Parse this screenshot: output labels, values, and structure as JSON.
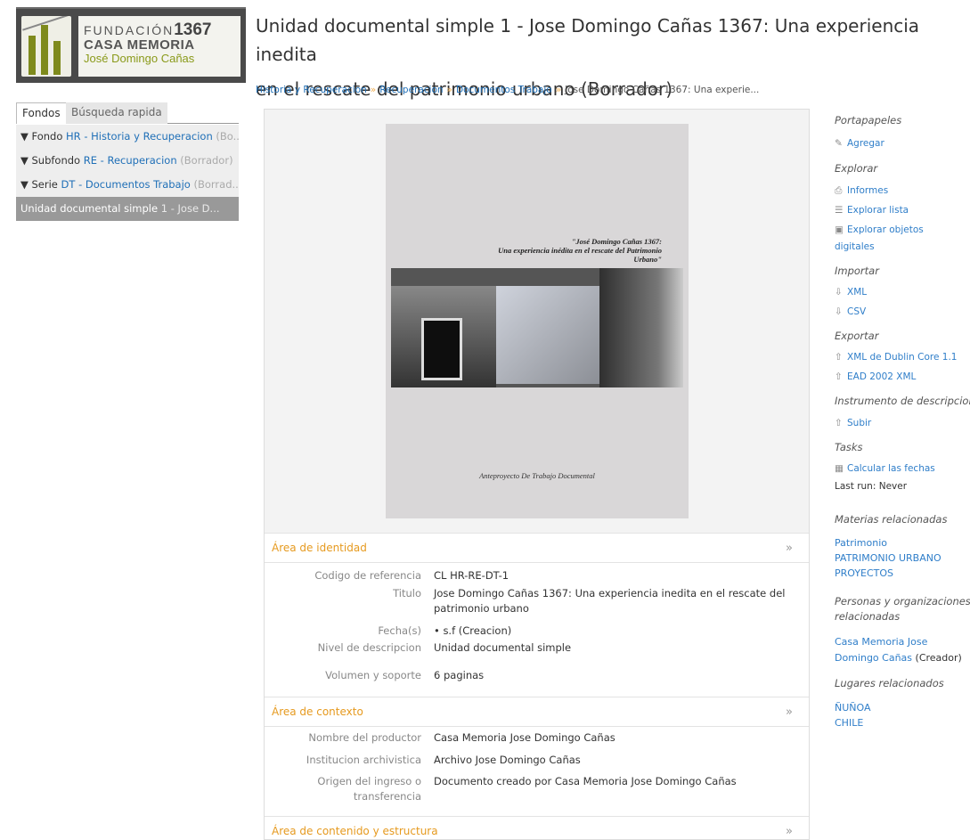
{
  "logo": {
    "line1_prefix": "FUNDACIÓN",
    "line1_number": "1367",
    "line2": "CASA MEMORIA",
    "line3": "José Domingo Cañas"
  },
  "sidebar": {
    "tabs": [
      "Fondos",
      "Búsqueda rapida"
    ],
    "tree": [
      {
        "prefix": "▼ Fondo ",
        "link": "HR - Historia y Recuperacion",
        "status": " (Bo..."
      },
      {
        "prefix": "▼ Subfondo ",
        "link": "RE - Recuperacion",
        "status": " (Borrador)"
      },
      {
        "prefix": "▼ Serie ",
        "link": "DT - Documentos Trabajo",
        "status": " (Borrad..."
      },
      {
        "prefix": "Unidad documental simple ",
        "link": "1 - Jose D...",
        "status": ""
      }
    ]
  },
  "page": {
    "title_line1": "Unidad documental simple 1 - Jose Domingo Cañas 1367: Una experiencia inedita",
    "title_line2": "en el rescate del patrimonio urbano (Borrador)"
  },
  "breadcrumb": [
    "Historia y Recuperacion",
    "Recuperacion",
    "Documentos Trabajo",
    "Jose Domingo Cañas 1367: Una experie..."
  ],
  "preview": {
    "quote_line1": "\"José Domingo Cañas 1367:",
    "quote_line2": "Una experiencia inédita en el rescate del Patrimonio",
    "quote_line3": "Urbano\"",
    "bottom": "Anteproyecto De Trabajo Documental"
  },
  "identity": {
    "heading": "Área de identidad",
    "chev": "»",
    "fields": [
      {
        "label": "Codigo de referencia",
        "value": "CL HR-RE-DT-1"
      },
      {
        "label": "Titulo",
        "value": "Jose Domingo Cañas 1367: Una experiencia inedita en el rescate del patrimonio urbano"
      },
      {
        "label": "Fecha(s)",
        "value": "•  s.f (Creacion)"
      },
      {
        "label": "Nivel de descripcion",
        "value": "Unidad documental simple"
      },
      {
        "label": "Volumen y soporte",
        "value": "6 paginas"
      }
    ]
  },
  "context": {
    "heading": "Área de contexto",
    "chev": "»",
    "fields": [
      {
        "label": "Nombre del productor",
        "value": "Casa Memoria Jose Domingo Cañas"
      },
      {
        "label": "Institucion archivistica",
        "value": "Archivo Jose Domingo Cañas"
      },
      {
        "label": "Origen del ingreso o transferencia",
        "value": "Documento creado por Casa Memoria Jose Domingo Cañas"
      }
    ]
  },
  "content_section": {
    "heading": "Área de contenido y estructura",
    "chev": "»"
  },
  "right": {
    "portapapeles": "Portapapeles",
    "agregar": "Agregar",
    "explorar": "Explorar",
    "informes": "Informes",
    "explorar_lista": "Explorar lista",
    "explorar_objetos_1": "Explorar objetos",
    "explorar_objetos_2": "digitales",
    "importar": "Importar",
    "xml": "XML",
    "csv": "CSV",
    "exportar": "Exportar",
    "xml_dublin": "XML de Dublin Core 1.1",
    "ead": "EAD 2002 XML",
    "instrumento": "Instrumento de descripcion",
    "subir": "Subir",
    "tasks": "Tasks",
    "calcular": "Calcular las fechas",
    "last_run": "Last run: Never",
    "materias": "Materias relacionadas",
    "materia_items": [
      "Patrimonio",
      "PATRIMONIO URBANO",
      "PROYECTOS"
    ],
    "personas_1": "Personas y organizaciones",
    "personas_2": "relacionadas",
    "persona_link_1": "Casa Memoria Jose",
    "persona_link_2": "Domingo Cañas",
    "persona_role": " (Creador)",
    "lugares": "Lugares relacionados",
    "lugar_items": [
      "ÑUÑOA",
      "CHILE"
    ]
  },
  "colors": {
    "link": "#1f6fb7",
    "section_heading": "#e69a1f",
    "selected_node": "#999999"
  }
}
